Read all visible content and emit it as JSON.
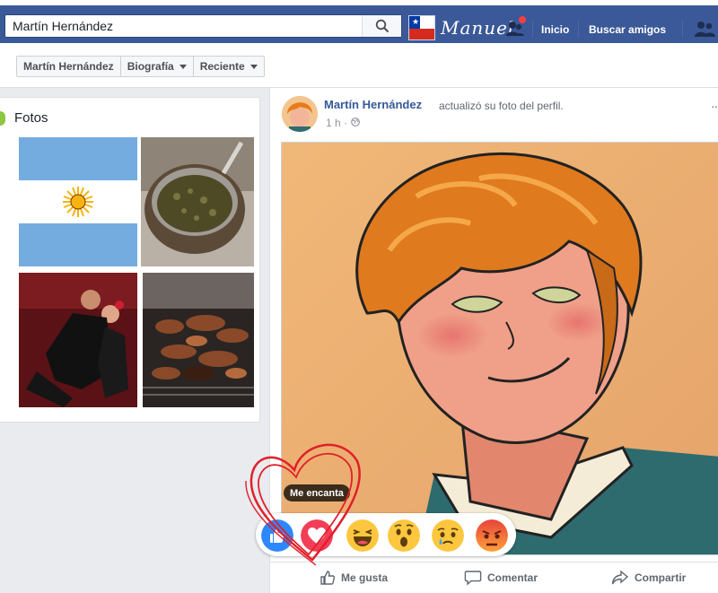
{
  "topbar": {
    "search_value": "Martín Hernández",
    "profile_name": "Manuel",
    "nav_home": "Inicio",
    "nav_find_friends": "Buscar amigos",
    "accent": "#3b5998"
  },
  "profile_nav": {
    "items": [
      "Martín Hernández",
      "Biografía",
      "Reciente"
    ]
  },
  "photos": {
    "title": "Fotos"
  },
  "post": {
    "author": "Martín Hernández",
    "action": "actualizó su foto del perfil.",
    "time": "1 h ·",
    "more": "···",
    "actions": {
      "like": "Me gusta",
      "comment": "Comentar",
      "share": "Compartir"
    }
  },
  "reactions": {
    "tooltip": "Me encanta",
    "items": [
      "like-icon",
      "love-icon",
      "haha-icon",
      "wow-icon",
      "sad-icon",
      "angry-icon"
    ]
  }
}
